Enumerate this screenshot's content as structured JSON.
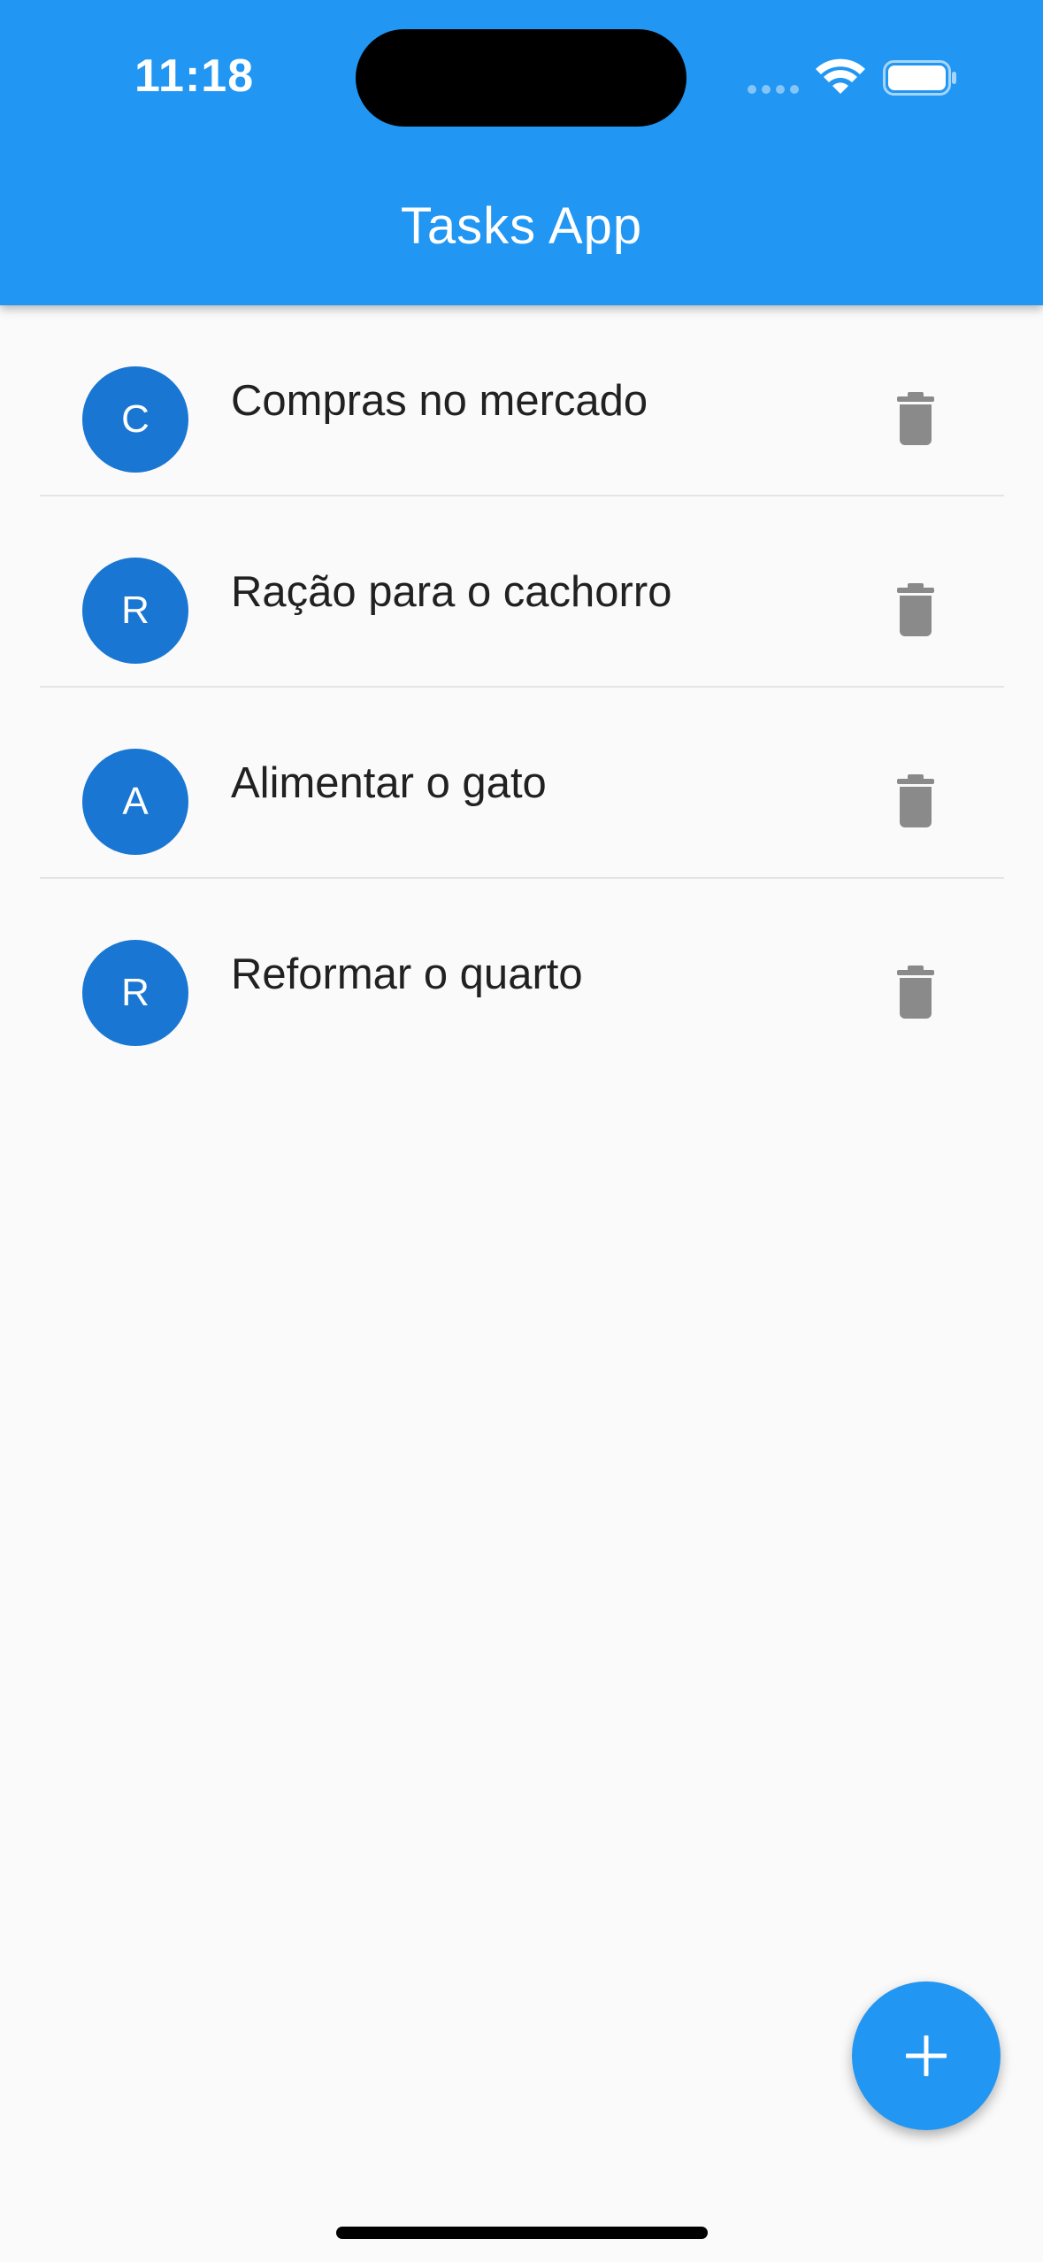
{
  "status_bar": {
    "time": "11:18"
  },
  "app_bar": {
    "title": "Tasks App",
    "color": "#2196f3"
  },
  "tasks": [
    {
      "initial": "C",
      "title": "Compras no mercado",
      "delete_icon": "trash-icon"
    },
    {
      "initial": "R",
      "title": "Ração para o cachorro",
      "delete_icon": "trash-icon"
    },
    {
      "initial": "A",
      "title": "Alimentar o gato",
      "delete_icon": "trash-icon"
    },
    {
      "initial": "R",
      "title": "Reformar o quarto",
      "delete_icon": "trash-icon"
    }
  ],
  "fab": {
    "icon": "plus-icon",
    "color": "#2196f3"
  },
  "colors": {
    "avatar": "#1976d2",
    "delete_icon": "#8a8a8a",
    "background": "#fafafa"
  }
}
